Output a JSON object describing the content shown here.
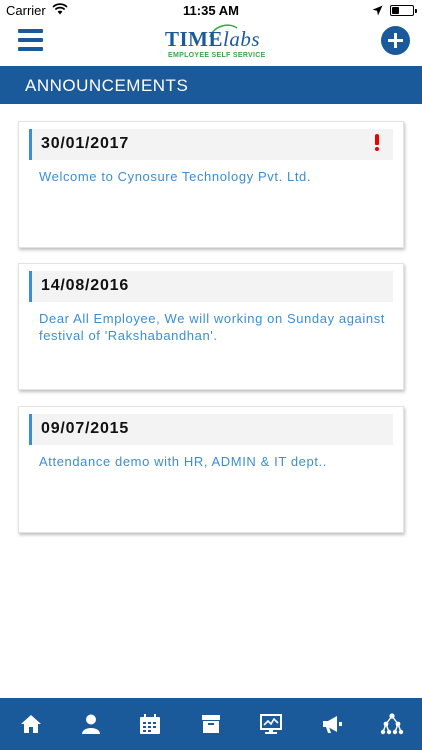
{
  "status_bar": {
    "carrier": "Carrier",
    "time": "11:35 AM",
    "battery_level": 0.35
  },
  "nav": {
    "logo_text_1": "TIME",
    "logo_text_2": "labs",
    "logo_tagline": "EMPLOYEE SELF SERVICE"
  },
  "section": {
    "title": "ANNOUNCEMENTS"
  },
  "announcements": [
    {
      "date": "30/01/2017",
      "message": "Welcome to Cynosure Technology Pvt. Ltd.",
      "important": true
    },
    {
      "date": "14/08/2016",
      "message": "Dear All Employee, We will working on Sunday against festival of 'Rakshabandhan'.",
      "important": false
    },
    {
      "date": "09/07/2015",
      "message": "Attendance demo with HR, ADMIN & IT dept..",
      "important": false
    }
  ],
  "tab_bar": {
    "items": [
      "home-icon",
      "profile-icon",
      "calendar-icon",
      "archive-icon",
      "monitor-icon",
      "megaphone-icon",
      "hierarchy-icon"
    ]
  },
  "colors": {
    "primary": "#1a5a9a",
    "accent": "#3a8ed6",
    "alert": "#ee0000",
    "tagline": "#3aa648"
  }
}
